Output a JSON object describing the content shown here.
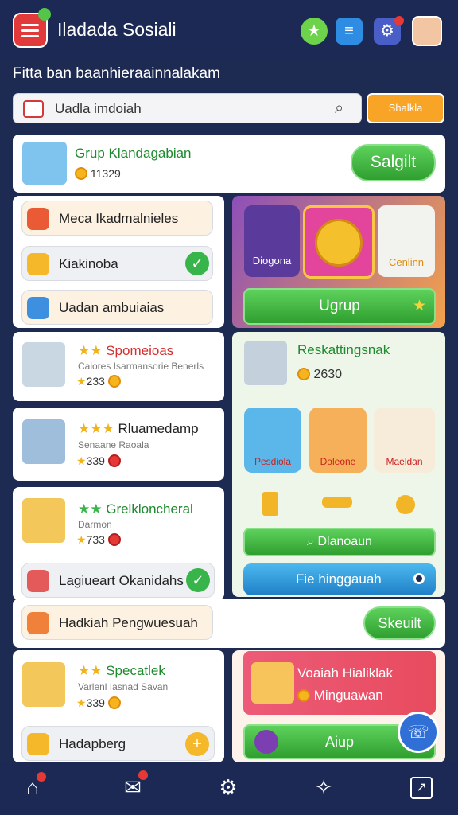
{
  "header": {
    "title": "Iladada Sosiali",
    "subtitle": "Fitta ban baanhieraainnalakam"
  },
  "search": {
    "value": "Uadla imdoiah",
    "filter_label": "Shalkla"
  },
  "group": {
    "name": "Grup Klandagabian",
    "coins": "11329",
    "button": "Salgilt"
  },
  "menu": [
    {
      "label": "Meca Ikadmalnieles"
    },
    {
      "label": "Kiakinoba"
    },
    {
      "label": "Uadan ambuiaias"
    },
    {
      "label": "Lagiueart Okanidahs"
    },
    {
      "label": "Hadkiah Pengwuesuah"
    },
    {
      "label": "Hadapberg"
    }
  ],
  "promo": {
    "tile_left": "Diogona",
    "tile_right": "Cenlinn",
    "button": "Ugrup"
  },
  "users": [
    {
      "name": "Spomeioas",
      "desc": "Caiores Isarmansorie Benerls",
      "rating": "233"
    },
    {
      "name": "Rluamedamp",
      "desc": "Senaane Raoala",
      "rating": "339"
    },
    {
      "name": "Grelkloncheral",
      "desc": "Darmon",
      "rating": "733"
    },
    {
      "name": "Specatlek",
      "desc": "Varlenl Iasnad Savan",
      "rating": "339"
    }
  ],
  "friend": {
    "name": "Reskattingsnak",
    "coins": "2630",
    "tiles": [
      "Pesdiola",
      "Doleone",
      "Maeldan"
    ],
    "green_btn": "Dlanoaun",
    "blue_btn": "Fie hinggauah"
  },
  "share_button": "Skeuilt",
  "gift": {
    "title": "Voaiah Hialiklak",
    "sub": "Minguawan",
    "button": "Aiup"
  },
  "colors": {
    "bg": "#1d2a52",
    "green": "#38b54a",
    "orange": "#f7a427"
  }
}
